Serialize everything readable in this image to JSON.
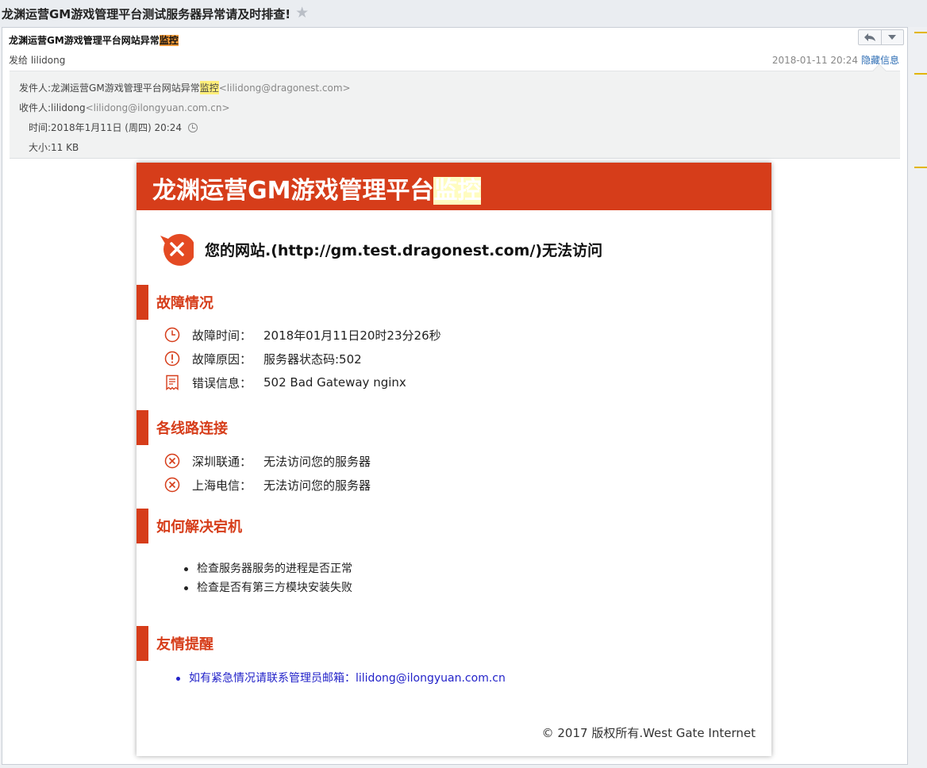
{
  "topbar": {
    "subject": "龙渊运营GM游戏管理平台测试服务器异常请及时排查!"
  },
  "header": {
    "title_prefix": "龙渊运营GM游戏管理平台网站异常",
    "title_highlight": "监控",
    "sent_to": "发给 lilidong",
    "date": "2018-01-11 20:24",
    "hide_info": "隐藏信息"
  },
  "details": {
    "from_label": "发件人: ",
    "from_name_prefix": "龙渊运营GM游戏管理平台网站异常",
    "from_name_highlight": "监控",
    "from_email": "<lilidong@dragonest.com>",
    "to_label": "收件人: ",
    "to_name": "lilidong",
    "to_email": "<lilidong@ilongyuan.com.cn>",
    "time_label": "时间: ",
    "time_value": "2018年1月11日 (周四) 20:24",
    "size_label": "大小: ",
    "size_value": "11 KB"
  },
  "card": {
    "title_prefix": "龙渊运营GM游戏管理平台",
    "title_highlight": "监控",
    "alert": "您的网站.(http://gm.test.dragonest.com/)无法访问",
    "sections": {
      "fault": {
        "title": "故障情况",
        "items": [
          {
            "icon": "clock-icon",
            "label": "故障时间：",
            "value": "2018年01月11日20时23分26秒"
          },
          {
            "icon": "exclamation-icon",
            "label": "故障原因：",
            "value": "服务器状态码:502"
          },
          {
            "icon": "receipt-icon",
            "label": "错误信息：",
            "value": "502 Bad Gateway nginx"
          }
        ]
      },
      "lines": {
        "title": "各线路连接",
        "items": [
          {
            "icon": "error-circle-icon",
            "label": "深圳联通：",
            "value": "无法访问您的服务器"
          },
          {
            "icon": "error-circle-icon",
            "label": "上海电信：",
            "value": "无法访问您的服务器"
          }
        ]
      },
      "fix": {
        "title": "如何解决宕机",
        "bullets": [
          "检查服务器服务的进程是否正常",
          "检查是否有第三方模块安装失败"
        ]
      },
      "tips": {
        "title": "友情提醒",
        "bullets": [
          "如有紧急情况请联系管理员邮箱：lilidong@ilongyuan.com.cn"
        ]
      }
    },
    "footer": "© 2017 版权所有.West Gate Internet"
  },
  "colors": {
    "accent": "#d63d1a",
    "link": "#2d6db4",
    "highlight": "#ffef7a"
  }
}
